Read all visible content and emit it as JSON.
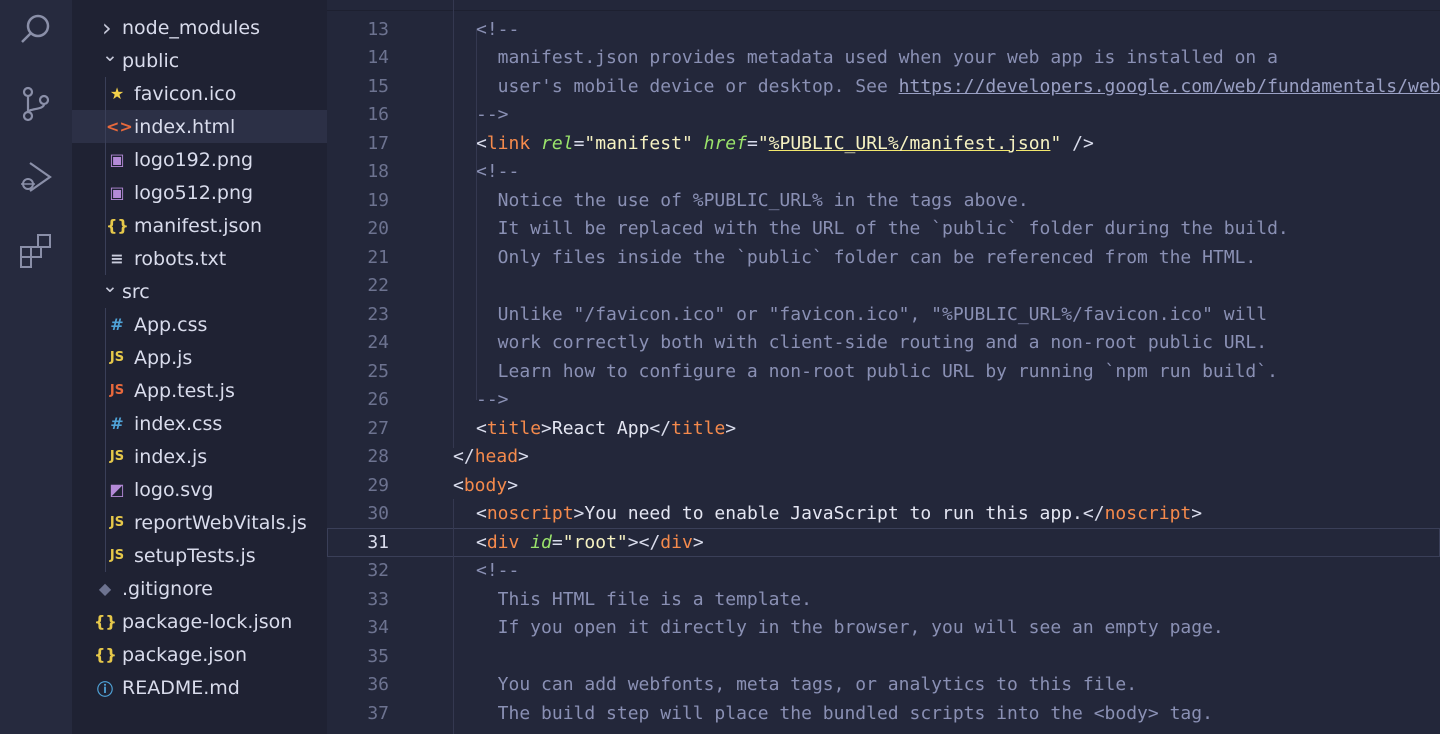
{
  "sidebar": {
    "items": [
      {
        "label": "node_modules",
        "type": "folder",
        "expanded": false,
        "icon": "chevron-right-icon"
      },
      {
        "label": "public",
        "type": "folder",
        "expanded": true,
        "icon": "chevron-down-icon"
      },
      {
        "label": "favicon.ico",
        "type": "file",
        "icon": "star-icon",
        "glyph": "★",
        "color": "#f2d04a"
      },
      {
        "label": "index.html",
        "type": "file",
        "icon": "html-icon",
        "glyph": "<>",
        "color": "#e8693c",
        "selected": true
      },
      {
        "label": "logo192.png",
        "type": "file",
        "icon": "image-icon",
        "glyph": "▣",
        "color": "#b48ad8"
      },
      {
        "label": "logo512.png",
        "type": "file",
        "icon": "image-icon",
        "glyph": "▣",
        "color": "#b48ad8"
      },
      {
        "label": "manifest.json",
        "type": "file",
        "icon": "json-icon",
        "glyph": "{}",
        "color": "#e6c84a"
      },
      {
        "label": "robots.txt",
        "type": "file",
        "icon": "text-file-icon",
        "glyph": "≡",
        "color": "#c9ccdc"
      },
      {
        "label": "src",
        "type": "folder",
        "expanded": true,
        "icon": "chevron-down-icon"
      },
      {
        "label": "App.css",
        "type": "file",
        "icon": "css-icon",
        "glyph": "#",
        "color": "#4fa3d8"
      },
      {
        "label": "App.js",
        "type": "file",
        "icon": "js-icon",
        "glyph": "JS",
        "color": "#e6c84a"
      },
      {
        "label": "App.test.js",
        "type": "file",
        "icon": "js-test-icon",
        "glyph": "JS",
        "color": "#e8693c"
      },
      {
        "label": "index.css",
        "type": "file",
        "icon": "css-icon",
        "glyph": "#",
        "color": "#4fa3d8"
      },
      {
        "label": "index.js",
        "type": "file",
        "icon": "js-icon",
        "glyph": "JS",
        "color": "#e6c84a"
      },
      {
        "label": "logo.svg",
        "type": "file",
        "icon": "svg-icon",
        "glyph": "◩",
        "color": "#b48ad8"
      },
      {
        "label": "reportWebVitals.js",
        "type": "file",
        "icon": "js-icon",
        "glyph": "JS",
        "color": "#e6c84a"
      },
      {
        "label": "setupTests.js",
        "type": "file",
        "icon": "js-icon",
        "glyph": "JS",
        "color": "#e6c84a"
      },
      {
        "label": ".gitignore",
        "type": "file",
        "icon": "git-icon",
        "glyph": "◆",
        "color": "#6d7390"
      },
      {
        "label": "package-lock.json",
        "type": "file",
        "icon": "json-icon",
        "glyph": "{}",
        "color": "#e6c84a"
      },
      {
        "label": "package.json",
        "type": "file",
        "icon": "json-icon",
        "glyph": "{}",
        "color": "#e6c84a"
      },
      {
        "label": "README.md",
        "type": "file",
        "icon": "info-icon",
        "glyph": "ⓘ",
        "color": "#4fa3d8"
      }
    ]
  },
  "editor": {
    "current_line": 31,
    "lines": [
      {
        "n": "13",
        "segs": [
          [
            "c-com",
            "<!--"
          ]
        ]
      },
      {
        "n": "14",
        "segs": [
          [
            "c-com",
            "  manifest.json provides metadata used when your web app is installed on a"
          ]
        ]
      },
      {
        "n": "15",
        "segs": [
          [
            "c-com",
            "  user's mobile device or desktop. See "
          ],
          [
            "c-link",
            "https://developers.google.com/web/fundamentals/web-app-manifest/"
          ]
        ]
      },
      {
        "n": "16",
        "segs": [
          [
            "c-com",
            "-->"
          ]
        ]
      },
      {
        "n": "17",
        "segs": [
          [
            "c-br",
            "<"
          ],
          [
            "c-tag",
            "link"
          ],
          [
            "c-br",
            " "
          ],
          [
            "c-attr",
            "rel"
          ],
          [
            "c-br",
            "="
          ],
          [
            "c-str",
            "\"manifest\""
          ],
          [
            "c-br",
            " "
          ],
          [
            "c-attr",
            "href"
          ],
          [
            "c-br",
            "="
          ],
          [
            "c-str",
            "\""
          ],
          [
            "c-str c-hl",
            "%PUBLIC_URL%/manifest.json"
          ],
          [
            "c-str",
            "\""
          ],
          [
            "c-br",
            " />"
          ]
        ]
      },
      {
        "n": "18",
        "segs": [
          [
            "c-com",
            "<!--"
          ]
        ]
      },
      {
        "n": "19",
        "segs": [
          [
            "c-com",
            "  Notice the use of %PUBLIC_URL% in the tags above."
          ]
        ]
      },
      {
        "n": "20",
        "segs": [
          [
            "c-com",
            "  It will be replaced with the URL of the `public` folder during the build."
          ]
        ]
      },
      {
        "n": "21",
        "segs": [
          [
            "c-com",
            "  Only files inside the `public` folder can be referenced from the HTML."
          ]
        ]
      },
      {
        "n": "22",
        "segs": []
      },
      {
        "n": "23",
        "segs": [
          [
            "c-com",
            "  Unlike \"/favicon.ico\" or \"favicon.ico\", \"%PUBLIC_URL%/favicon.ico\" will"
          ]
        ]
      },
      {
        "n": "24",
        "segs": [
          [
            "c-com",
            "  work correctly both with client-side routing and a non-root public URL."
          ]
        ]
      },
      {
        "n": "25",
        "segs": [
          [
            "c-com",
            "  Learn how to configure a non-root public URL by running `npm run build`."
          ]
        ]
      },
      {
        "n": "26",
        "segs": [
          [
            "c-com",
            "-->"
          ]
        ]
      },
      {
        "n": "27",
        "segs": [
          [
            "c-br",
            "<"
          ],
          [
            "c-tag",
            "title"
          ],
          [
            "c-br",
            ">"
          ],
          [
            "c-txt",
            "React App"
          ],
          [
            "c-br",
            "</"
          ],
          [
            "c-tag",
            "title"
          ],
          [
            "c-br",
            ">"
          ]
        ]
      },
      {
        "n": "28",
        "out": true,
        "segs": [
          [
            "c-br",
            "</"
          ],
          [
            "c-tag",
            "head"
          ],
          [
            "c-br",
            ">"
          ]
        ]
      },
      {
        "n": "29",
        "out": true,
        "segs": [
          [
            "c-br",
            "<"
          ],
          [
            "c-tag",
            "body"
          ],
          [
            "c-br",
            ">"
          ]
        ]
      },
      {
        "n": "30",
        "segs": [
          [
            "c-br",
            "<"
          ],
          [
            "c-tag",
            "noscript"
          ],
          [
            "c-br",
            ">"
          ],
          [
            "c-txt",
            "You need to enable JavaScript to run this app."
          ],
          [
            "c-br",
            "</"
          ],
          [
            "c-tag",
            "noscript"
          ],
          [
            "c-br",
            ">"
          ]
        ]
      },
      {
        "n": "31",
        "segs": [
          [
            "c-br",
            "<"
          ],
          [
            "c-tag",
            "div"
          ],
          [
            "c-br",
            " "
          ],
          [
            "c-attr",
            "id"
          ],
          [
            "c-br",
            "="
          ],
          [
            "c-str",
            "\"root\""
          ],
          [
            "c-br",
            ">"
          ],
          [
            "c-br",
            "</"
          ],
          [
            "c-tag",
            "div"
          ],
          [
            "c-br",
            ">"
          ]
        ]
      },
      {
        "n": "32",
        "segs": [
          [
            "c-com",
            "<!--"
          ]
        ]
      },
      {
        "n": "33",
        "segs": [
          [
            "c-com",
            "  This HTML file is a template."
          ]
        ]
      },
      {
        "n": "34",
        "segs": [
          [
            "c-com",
            "  If you open it directly in the browser, you will see an empty page."
          ]
        ]
      },
      {
        "n": "35",
        "segs": []
      },
      {
        "n": "36",
        "segs": [
          [
            "c-com",
            "  You can add webfonts, meta tags, or analytics to this file."
          ]
        ]
      },
      {
        "n": "37",
        "segs": [
          [
            "c-com",
            "  The build step will place the bundled scripts into the <body> tag."
          ]
        ]
      }
    ]
  }
}
